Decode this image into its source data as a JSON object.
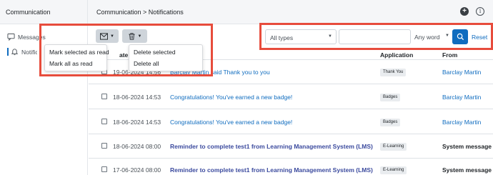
{
  "sidebar": {
    "title": "Communication",
    "items": [
      {
        "label": "Messages",
        "icon": "message-icon"
      },
      {
        "label": "Notifications",
        "icon": "bell-icon"
      }
    ]
  },
  "header": {
    "breadcrumb": "Communication > Notifications",
    "plus_icon": "+",
    "info_icon": "i"
  },
  "toolbar": {
    "mark_menu": [
      "Mark selected as read",
      "Mark all as read"
    ],
    "delete_menu": [
      "Delete selected",
      "Delete all"
    ]
  },
  "filter": {
    "type_value": "All types",
    "word_value": "Any word",
    "search_value": "",
    "reset_label": "Reset"
  },
  "table": {
    "headers": {
      "date": "Date",
      "application": "Application",
      "from": "From"
    },
    "date_partial": "ate",
    "rows": [
      {
        "date": "19-06-2024 14:56",
        "subject": "Barclay Martin said Thank you to you",
        "app": "Thank You",
        "from": "Barclay Martin",
        "unread": false,
        "system": false
      },
      {
        "date": "18-06-2024 14:53",
        "subject": "Congratulations! You've earned a new badge!",
        "app": "Badges",
        "from": "Barclay Martin",
        "unread": false,
        "system": false
      },
      {
        "date": "18-06-2024 14:53",
        "subject": "Congratulations! You've earned a new badge!",
        "app": "Badges",
        "from": "Barclay Martin",
        "unread": false,
        "system": false
      },
      {
        "date": "18-06-2024 08:00",
        "subject": "Reminder to complete test1 from Learning Management System (LMS)",
        "app": "E-Learning",
        "from": "System message",
        "unread": true,
        "system": true
      },
      {
        "date": "17-06-2024 08:00",
        "subject": "Reminder to complete test1 from Learning Management System (LMS)",
        "app": "E-Learning",
        "from": "System message",
        "unread": true,
        "system": true
      }
    ]
  },
  "colors": {
    "accent": "#0f6cbf",
    "highlight": "#e74c3c",
    "toolbar_button": "#ced4da"
  }
}
